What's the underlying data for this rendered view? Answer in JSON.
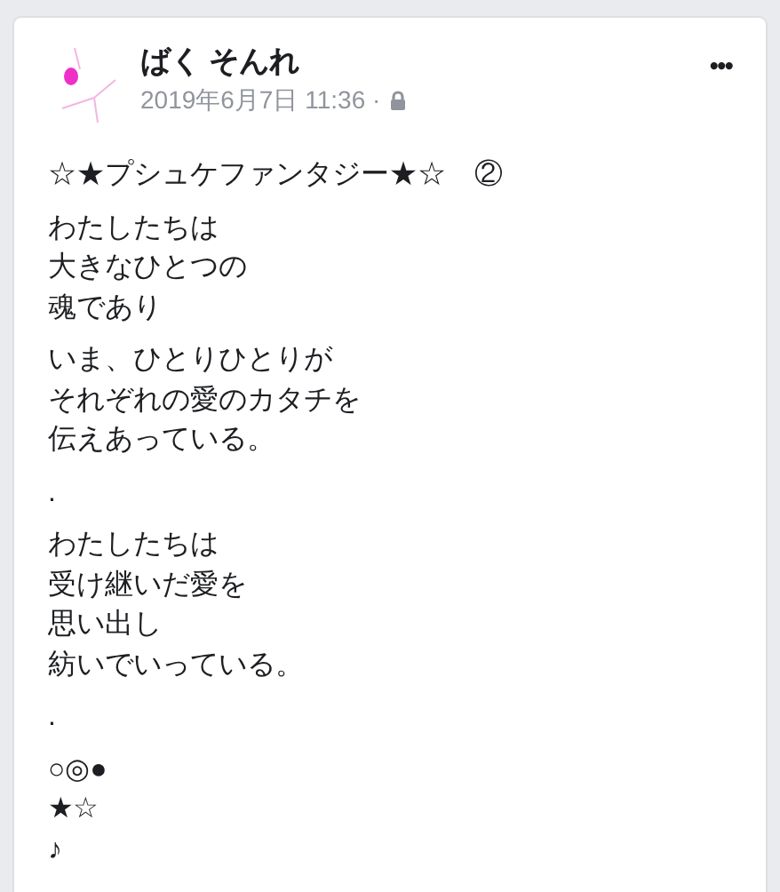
{
  "post": {
    "author": "ばく そんれ",
    "timestamp": "2019年6月7日 11:36 ·",
    "more_button": "•••",
    "paragraphs": [
      [
        "☆★プシュケファンタジー★☆　②"
      ],
      [
        "わたしたちは",
        "大きなひとつの",
        "魂であり"
      ],
      [
        "いま、ひとりひとりが",
        "それぞれの愛のカタチを",
        "伝えあっている。"
      ],
      [
        "."
      ],
      [
        "わたしたちは",
        "受け継いだ愛を",
        "思い出し",
        "紡いでいっている。"
      ],
      [
        "."
      ],
      [
        "○◎●",
        "★☆",
        "♪"
      ]
    ]
  }
}
